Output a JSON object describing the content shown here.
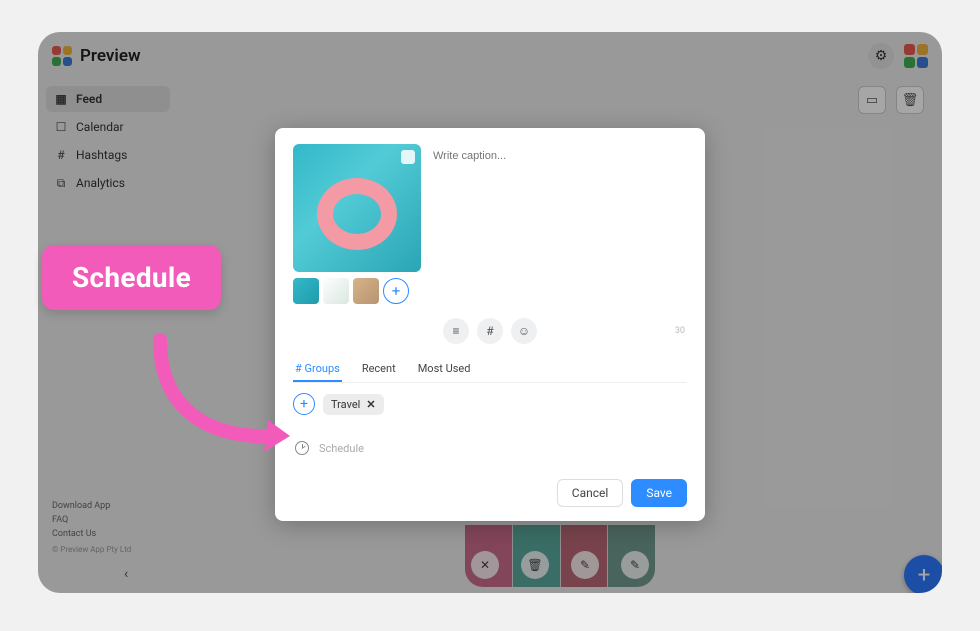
{
  "header": {
    "title": "Preview",
    "logo_colors": [
      "#e95a4f",
      "#f0b23c",
      "#3fae52",
      "#3d7ad9"
    ]
  },
  "sidebar": {
    "items": [
      {
        "label": "Feed",
        "active": true,
        "icon": "grid"
      },
      {
        "label": "Calendar",
        "active": false,
        "icon": "calendar"
      },
      {
        "label": "Hashtags",
        "active": false,
        "icon": "hash"
      },
      {
        "label": "Analytics",
        "active": false,
        "icon": "chart"
      }
    ],
    "footer": [
      "Download App",
      "FAQ",
      "Contact Us"
    ],
    "copyright": "© Preview App Pty Ltd"
  },
  "callout": {
    "label": "Schedule"
  },
  "modal": {
    "caption_placeholder": "Write caption...",
    "char_count": "30",
    "tabs": [
      "# Groups",
      "Recent",
      "Most Used"
    ],
    "active_tab": 0,
    "group_chip": "Travel",
    "schedule_placeholder": "Schedule",
    "cancel": "Cancel",
    "save": "Save"
  }
}
